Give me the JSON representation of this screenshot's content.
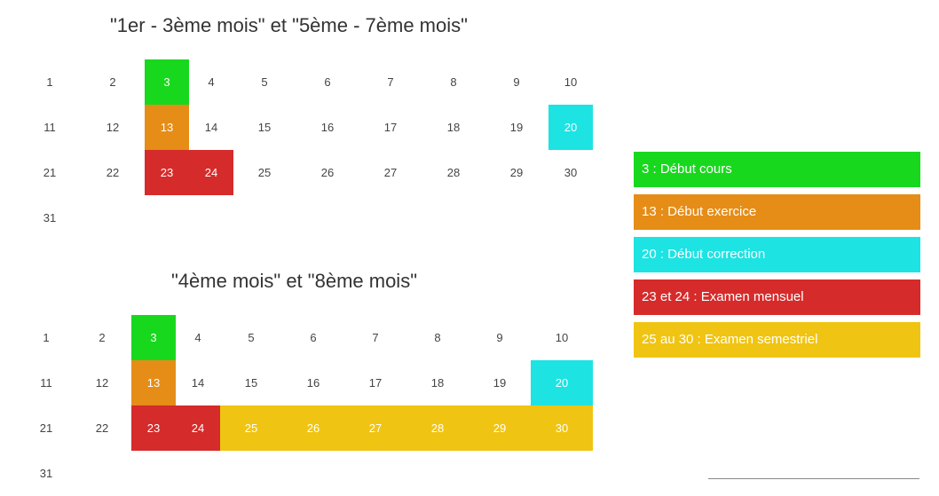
{
  "colors": {
    "green": "#18d81e",
    "orange": "#e58d17",
    "cyan": "#1de3e3",
    "red": "#d62b2b",
    "yellow": "#f0c412"
  },
  "calendars": [
    {
      "title": "\"1er - 3ème mois\" et \"5ème - 7ème mois\"",
      "days": [
        {
          "n": "1"
        },
        {
          "n": "2"
        },
        {
          "n": "3",
          "c": "green"
        },
        {
          "n": "4"
        },
        {
          "n": "5"
        },
        {
          "n": "6"
        },
        {
          "n": "7"
        },
        {
          "n": "8"
        },
        {
          "n": "9"
        },
        {
          "n": "10"
        },
        {
          "n": "11"
        },
        {
          "n": "12"
        },
        {
          "n": "13",
          "c": "orange"
        },
        {
          "n": "14"
        },
        {
          "n": "15"
        },
        {
          "n": "16"
        },
        {
          "n": "17"
        },
        {
          "n": "18"
        },
        {
          "n": "19"
        },
        {
          "n": "20",
          "c": "cyan"
        },
        {
          "n": "21"
        },
        {
          "n": "22"
        },
        {
          "n": "23",
          "c": "red"
        },
        {
          "n": "24",
          "c": "red"
        },
        {
          "n": "25"
        },
        {
          "n": "26"
        },
        {
          "n": "27"
        },
        {
          "n": "28"
        },
        {
          "n": "29"
        },
        {
          "n": "30"
        },
        {
          "n": "31"
        }
      ]
    },
    {
      "title": "\"4ème mois\" et \"8ème mois\"",
      "days": [
        {
          "n": "1"
        },
        {
          "n": "2"
        },
        {
          "n": "3",
          "c": "green"
        },
        {
          "n": "4"
        },
        {
          "n": "5"
        },
        {
          "n": "6"
        },
        {
          "n": "7"
        },
        {
          "n": "8"
        },
        {
          "n": "9"
        },
        {
          "n": "10"
        },
        {
          "n": "11"
        },
        {
          "n": "12"
        },
        {
          "n": "13",
          "c": "orange"
        },
        {
          "n": "14"
        },
        {
          "n": "15"
        },
        {
          "n": "16"
        },
        {
          "n": "17"
        },
        {
          "n": "18"
        },
        {
          "n": "19"
        },
        {
          "n": "20",
          "c": "cyan"
        },
        {
          "n": "21"
        },
        {
          "n": "22"
        },
        {
          "n": "23",
          "c": "red"
        },
        {
          "n": "24",
          "c": "red"
        },
        {
          "n": "25",
          "c": "yellow"
        },
        {
          "n": "26",
          "c": "yellow"
        },
        {
          "n": "27",
          "c": "yellow"
        },
        {
          "n": "28",
          "c": "yellow"
        },
        {
          "n": "29",
          "c": "yellow"
        },
        {
          "n": "30",
          "c": "yellow"
        },
        {
          "n": "31"
        }
      ]
    }
  ],
  "legend": [
    {
      "label": "3 : Début cours",
      "c": "green"
    },
    {
      "label": "13 : Début exercice",
      "c": "orange"
    },
    {
      "label": "20 : Début correction",
      "c": "cyan"
    },
    {
      "label": "23 et 24 : Examen mensuel",
      "c": "red"
    },
    {
      "label": "25 au 30 : Examen semestriel",
      "c": "yellow"
    }
  ]
}
